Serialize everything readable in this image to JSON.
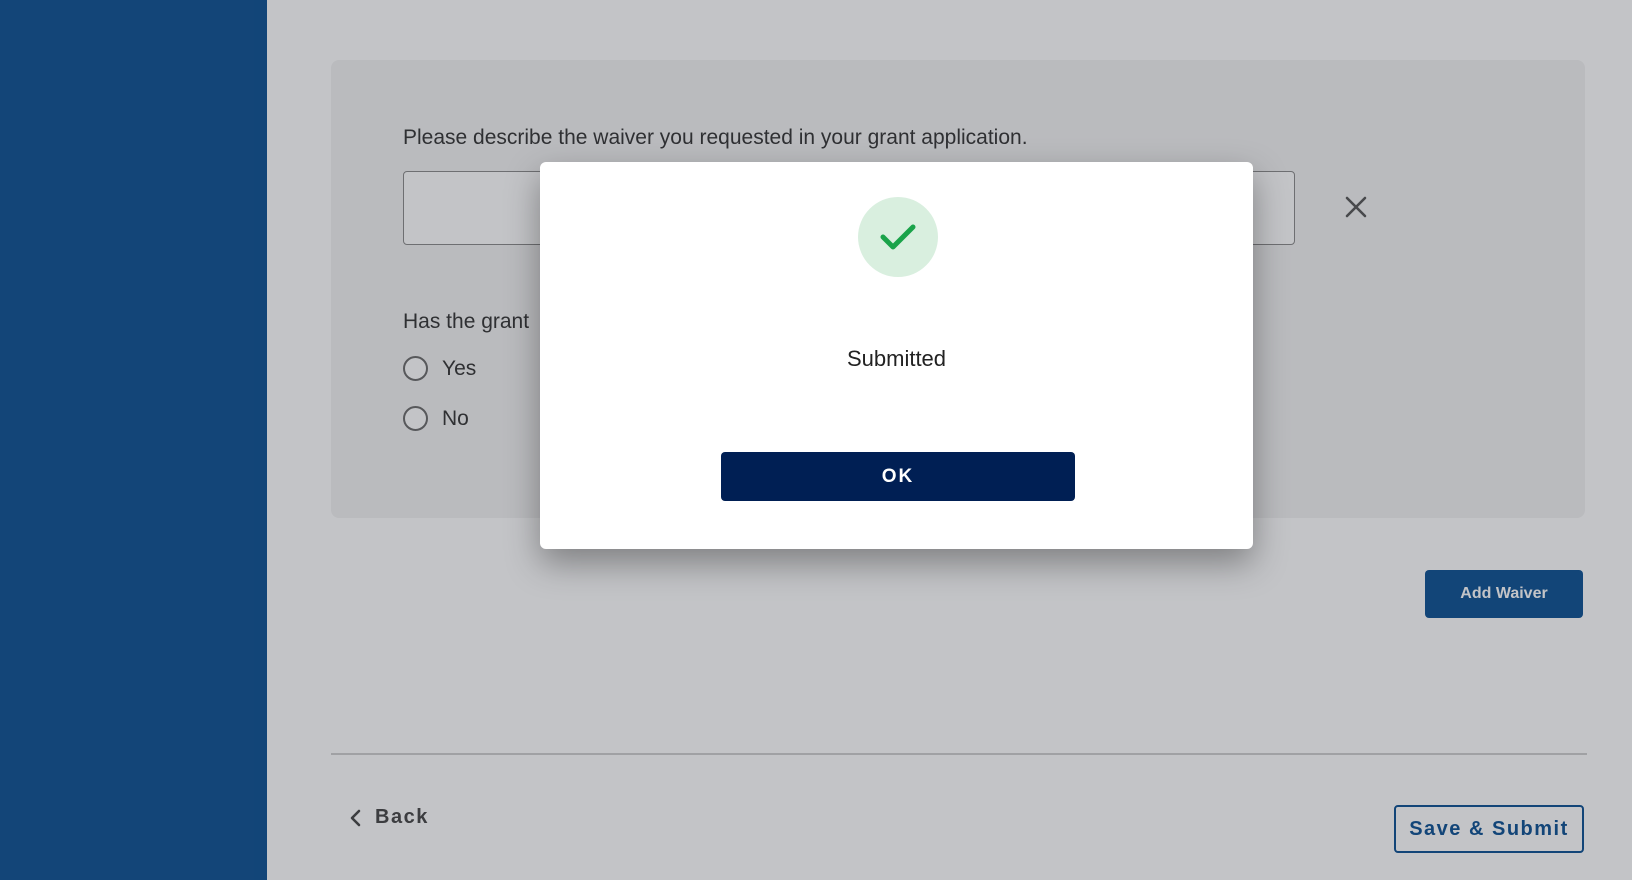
{
  "form": {
    "question1": "Please describe the waiver you requested in your grant application.",
    "question2_visible": "Has the grant",
    "options": [
      "Yes",
      "No"
    ],
    "add_waiver_label": "Add Waiver"
  },
  "footer": {
    "back_label": "Back",
    "submit_label": "Save & Submit"
  },
  "modal": {
    "message": "Submitted",
    "ok_label": "OK",
    "icon": "check-icon"
  },
  "colors": {
    "sidebar": "#0b4f92",
    "primary": "#001f54",
    "success_bg": "#d9efdf",
    "success": "#1aa34a"
  }
}
